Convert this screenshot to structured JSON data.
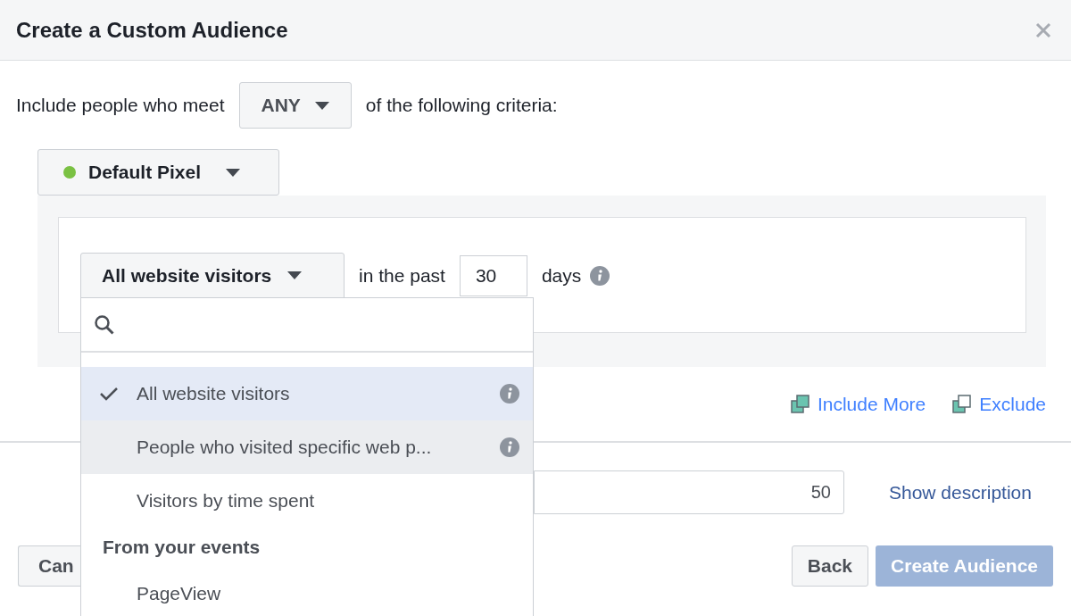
{
  "dialog": {
    "title": "Create a Custom Audience"
  },
  "criteria": {
    "prefix": "Include people who meet",
    "match": "ANY",
    "suffix": "of the following criteria:"
  },
  "pixel": {
    "label": "Default Pixel",
    "color": "#7ac143"
  },
  "rule": {
    "source": "All website visitors",
    "past_label": "in the past",
    "days": "30",
    "days_label": "days"
  },
  "menu": {
    "items": [
      {
        "kind": "option",
        "label": "All website visitors",
        "selected": true,
        "highlighted": false,
        "info": true
      },
      {
        "kind": "option",
        "label": "People who visited specific web p...",
        "selected": false,
        "highlighted": true,
        "info": true
      },
      {
        "kind": "option",
        "label": "Visitors by time spent",
        "selected": false,
        "highlighted": false,
        "info": false
      },
      {
        "kind": "heading",
        "label": "From your events"
      },
      {
        "kind": "option",
        "label": "PageView",
        "selected": false,
        "highlighted": false,
        "info": false
      }
    ]
  },
  "actions": [
    {
      "label": "Include More",
      "kind": "include"
    },
    {
      "label": "Exclude",
      "kind": "exclude"
    }
  ],
  "description": {
    "value": "50",
    "link": "Show description"
  },
  "footer": {
    "cancel": "Can",
    "back": "Back",
    "create": "Create Audience",
    "create_disabled": true
  }
}
